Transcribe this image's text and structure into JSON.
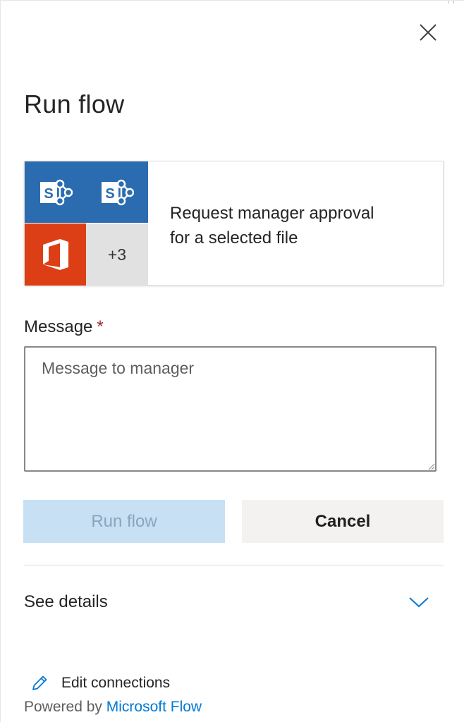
{
  "panel": {
    "title": "Run flow",
    "close_label": "Close"
  },
  "flow": {
    "name_line1": "Request manager approval",
    "name_line2": "for a selected file",
    "connectors": [
      {
        "icon": "sharepoint-icon"
      },
      {
        "icon": "sharepoint-icon"
      },
      {
        "icon": "office-icon"
      }
    ],
    "more_count": "+3"
  },
  "form": {
    "message_label": "Message",
    "required_mark": "*",
    "message_placeholder": "Message to manager",
    "message_value": ""
  },
  "actions": {
    "run_label": "Run flow",
    "cancel_label": "Cancel"
  },
  "details": {
    "label": "See details"
  },
  "footer": {
    "edit_connections_label": "Edit connections",
    "powered_by_prefix": "Powered by",
    "powered_by_link": "Microsoft Flow"
  },
  "colors": {
    "sharepoint": "#2b6cb0",
    "office": "#dc3e15",
    "accent": "#0078d4",
    "run_disabled_bg": "#c7e0f4",
    "required": "#a4262c"
  }
}
